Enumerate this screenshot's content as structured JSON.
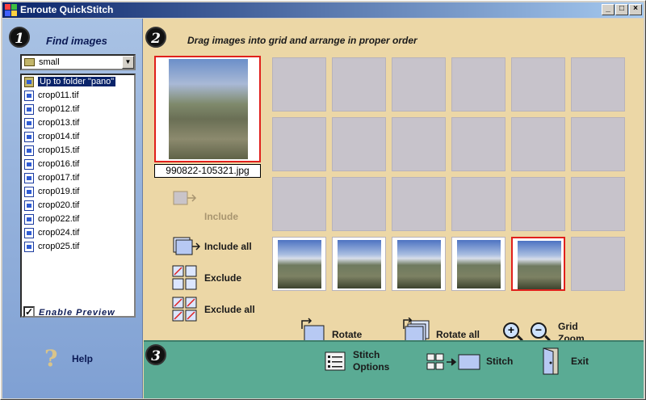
{
  "window": {
    "title": "Enroute QuickStitch"
  },
  "steps": {
    "one": "1",
    "two": "2",
    "three": "3"
  },
  "find_images": {
    "title": "Find images",
    "folder_combo": "small",
    "files": [
      "Up to folder \"pano\"",
      "crop011.tif",
      "crop012.tif",
      "crop013.tif",
      "crop014.tif",
      "crop015.tif",
      "crop016.tif",
      "crop017.tif",
      "crop019.tif",
      "crop020.tif",
      "crop022.tif",
      "crop024.tif",
      "crop025.tif"
    ],
    "selected_index": 0,
    "enable_preview_label": "Enable Preview",
    "enable_preview_checked": true,
    "help_label": "Help"
  },
  "arrange": {
    "title": "Drag images into grid and arrange in proper order",
    "preview_filename": "990822-105321.jpg",
    "include_label": "Include",
    "include_all_label": "Include all",
    "exclude_label": "Exclude",
    "exclude_all_label": "Exclude all",
    "rotate_label": "Rotate",
    "rotate_all_label": "Rotate all",
    "grid_zoom_label_1": "Grid",
    "grid_zoom_label_2": "Zoom"
  },
  "stitch_bar": {
    "stitch_options_1": "Stitch",
    "stitch_options_2": "Options",
    "stitch_label": "Stitch",
    "exit_label": "Exit"
  },
  "colors": {
    "title_bar_start": "#0a246a",
    "workspace": "#ecd7a6",
    "left_panel": "#a9c2e4",
    "bottom_bar": "#5aab94",
    "selection_border": "#e0201c"
  }
}
